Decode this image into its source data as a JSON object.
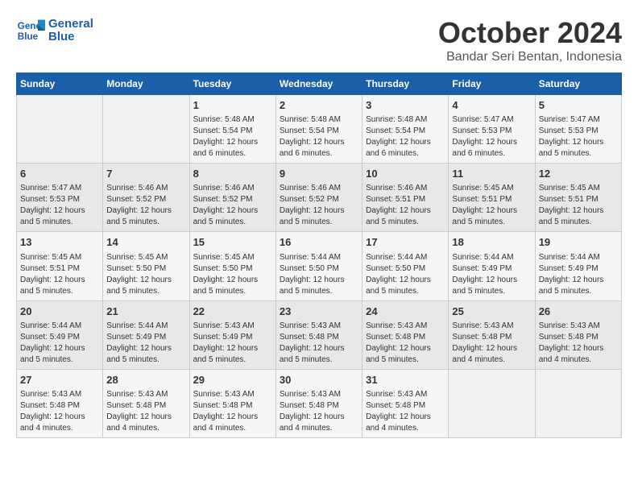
{
  "header": {
    "logo_line1": "General",
    "logo_line2": "Blue",
    "month": "October 2024",
    "location": "Bandar Seri Bentan, Indonesia"
  },
  "days_of_week": [
    "Sunday",
    "Monday",
    "Tuesday",
    "Wednesday",
    "Thursday",
    "Friday",
    "Saturday"
  ],
  "weeks": [
    [
      {
        "day": "",
        "info": ""
      },
      {
        "day": "",
        "info": ""
      },
      {
        "day": "1",
        "info": "Sunrise: 5:48 AM\nSunset: 5:54 PM\nDaylight: 12 hours\nand 6 minutes."
      },
      {
        "day": "2",
        "info": "Sunrise: 5:48 AM\nSunset: 5:54 PM\nDaylight: 12 hours\nand 6 minutes."
      },
      {
        "day": "3",
        "info": "Sunrise: 5:48 AM\nSunset: 5:54 PM\nDaylight: 12 hours\nand 6 minutes."
      },
      {
        "day": "4",
        "info": "Sunrise: 5:47 AM\nSunset: 5:53 PM\nDaylight: 12 hours\nand 6 minutes."
      },
      {
        "day": "5",
        "info": "Sunrise: 5:47 AM\nSunset: 5:53 PM\nDaylight: 12 hours\nand 5 minutes."
      }
    ],
    [
      {
        "day": "6",
        "info": "Sunrise: 5:47 AM\nSunset: 5:53 PM\nDaylight: 12 hours\nand 5 minutes."
      },
      {
        "day": "7",
        "info": "Sunrise: 5:46 AM\nSunset: 5:52 PM\nDaylight: 12 hours\nand 5 minutes."
      },
      {
        "day": "8",
        "info": "Sunrise: 5:46 AM\nSunset: 5:52 PM\nDaylight: 12 hours\nand 5 minutes."
      },
      {
        "day": "9",
        "info": "Sunrise: 5:46 AM\nSunset: 5:52 PM\nDaylight: 12 hours\nand 5 minutes."
      },
      {
        "day": "10",
        "info": "Sunrise: 5:46 AM\nSunset: 5:51 PM\nDaylight: 12 hours\nand 5 minutes."
      },
      {
        "day": "11",
        "info": "Sunrise: 5:45 AM\nSunset: 5:51 PM\nDaylight: 12 hours\nand 5 minutes."
      },
      {
        "day": "12",
        "info": "Sunrise: 5:45 AM\nSunset: 5:51 PM\nDaylight: 12 hours\nand 5 minutes."
      }
    ],
    [
      {
        "day": "13",
        "info": "Sunrise: 5:45 AM\nSunset: 5:51 PM\nDaylight: 12 hours\nand 5 minutes."
      },
      {
        "day": "14",
        "info": "Sunrise: 5:45 AM\nSunset: 5:50 PM\nDaylight: 12 hours\nand 5 minutes."
      },
      {
        "day": "15",
        "info": "Sunrise: 5:45 AM\nSunset: 5:50 PM\nDaylight: 12 hours\nand 5 minutes."
      },
      {
        "day": "16",
        "info": "Sunrise: 5:44 AM\nSunset: 5:50 PM\nDaylight: 12 hours\nand 5 minutes."
      },
      {
        "day": "17",
        "info": "Sunrise: 5:44 AM\nSunset: 5:50 PM\nDaylight: 12 hours\nand 5 minutes."
      },
      {
        "day": "18",
        "info": "Sunrise: 5:44 AM\nSunset: 5:49 PM\nDaylight: 12 hours\nand 5 minutes."
      },
      {
        "day": "19",
        "info": "Sunrise: 5:44 AM\nSunset: 5:49 PM\nDaylight: 12 hours\nand 5 minutes."
      }
    ],
    [
      {
        "day": "20",
        "info": "Sunrise: 5:44 AM\nSunset: 5:49 PM\nDaylight: 12 hours\nand 5 minutes."
      },
      {
        "day": "21",
        "info": "Sunrise: 5:44 AM\nSunset: 5:49 PM\nDaylight: 12 hours\nand 5 minutes."
      },
      {
        "day": "22",
        "info": "Sunrise: 5:43 AM\nSunset: 5:49 PM\nDaylight: 12 hours\nand 5 minutes."
      },
      {
        "day": "23",
        "info": "Sunrise: 5:43 AM\nSunset: 5:48 PM\nDaylight: 12 hours\nand 5 minutes."
      },
      {
        "day": "24",
        "info": "Sunrise: 5:43 AM\nSunset: 5:48 PM\nDaylight: 12 hours\nand 5 minutes."
      },
      {
        "day": "25",
        "info": "Sunrise: 5:43 AM\nSunset: 5:48 PM\nDaylight: 12 hours\nand 4 minutes."
      },
      {
        "day": "26",
        "info": "Sunrise: 5:43 AM\nSunset: 5:48 PM\nDaylight: 12 hours\nand 4 minutes."
      }
    ],
    [
      {
        "day": "27",
        "info": "Sunrise: 5:43 AM\nSunset: 5:48 PM\nDaylight: 12 hours\nand 4 minutes."
      },
      {
        "day": "28",
        "info": "Sunrise: 5:43 AM\nSunset: 5:48 PM\nDaylight: 12 hours\nand 4 minutes."
      },
      {
        "day": "29",
        "info": "Sunrise: 5:43 AM\nSunset: 5:48 PM\nDaylight: 12 hours\nand 4 minutes."
      },
      {
        "day": "30",
        "info": "Sunrise: 5:43 AM\nSunset: 5:48 PM\nDaylight: 12 hours\nand 4 minutes."
      },
      {
        "day": "31",
        "info": "Sunrise: 5:43 AM\nSunset: 5:48 PM\nDaylight: 12 hours\nand 4 minutes."
      },
      {
        "day": "",
        "info": ""
      },
      {
        "day": "",
        "info": ""
      }
    ]
  ]
}
